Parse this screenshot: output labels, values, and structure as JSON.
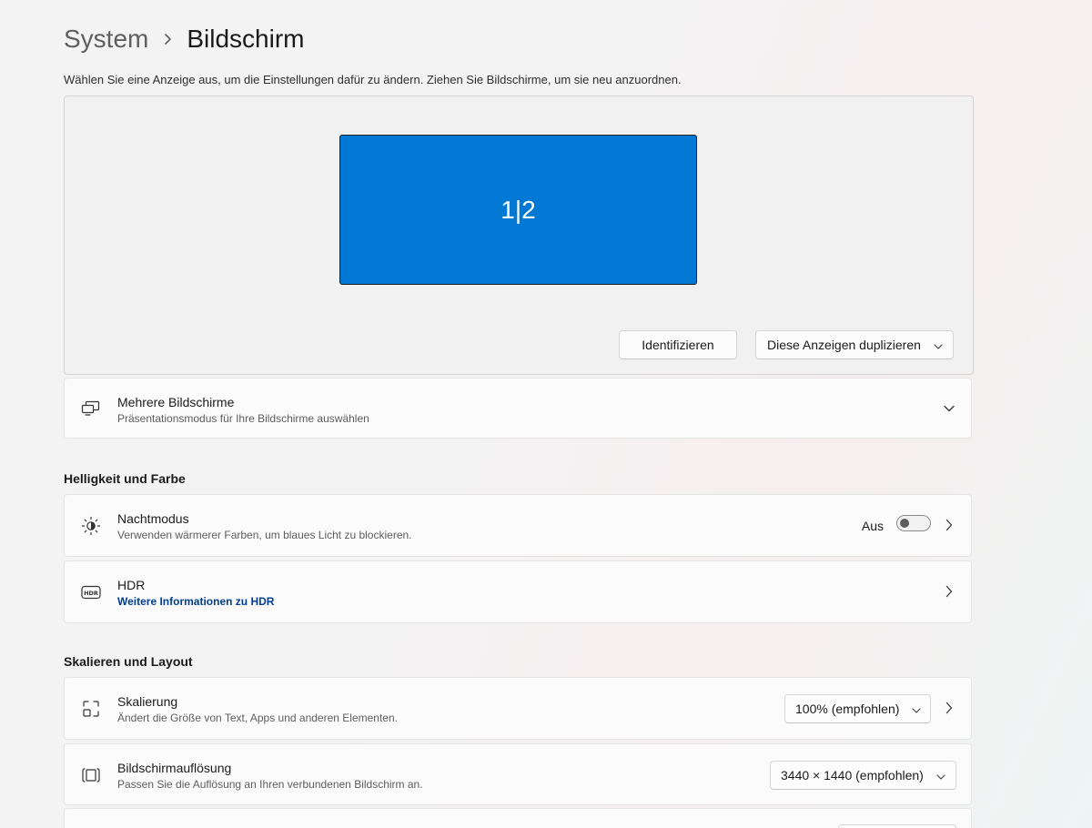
{
  "breadcrumb": {
    "parent": "System",
    "current": "Bildschirm"
  },
  "intro": "Wählen Sie eine Anzeige aus, um die Einstellungen dafür zu ändern. Ziehen Sie Bildschirme, um sie neu anzuordnen.",
  "arrangement": {
    "monitor_label": "1|2",
    "monitor_color": "#0078d4",
    "identify_label": "Identifizieren",
    "duplicate_label": "Diese Anzeigen duplizieren"
  },
  "multiple_displays": {
    "title": "Mehrere Bildschirme",
    "subtitle": "Präsentationsmodus für Ihre Bildschirme auswählen",
    "icon": "multiple-displays-icon"
  },
  "sections": {
    "brightness": "Helligkeit und Farbe",
    "scale_layout": "Skalieren und Layout"
  },
  "night_light": {
    "title": "Nachtmodus",
    "subtitle": "Verwenden wärmerer Farben, um blaues Licht zu blockieren.",
    "state_label": "Aus",
    "enabled": false,
    "icon": "brightness-icon"
  },
  "hdr": {
    "title": "HDR",
    "link": "Weitere Informationen zu HDR",
    "icon": "hdr-icon",
    "link_color": "#003e92"
  },
  "scaling": {
    "title": "Skalierung",
    "subtitle": "Ändert die Größe von Text, Apps und anderen Elementen.",
    "value": "100% (empfohlen)",
    "icon": "scale-icon"
  },
  "resolution": {
    "title": "Bildschirmauflösung",
    "subtitle": "Passen Sie die Auflösung an Ihren verbundenen Bildschirm an.",
    "value": "3440 × 1440 (empfohlen)",
    "icon": "resolution-icon"
  }
}
